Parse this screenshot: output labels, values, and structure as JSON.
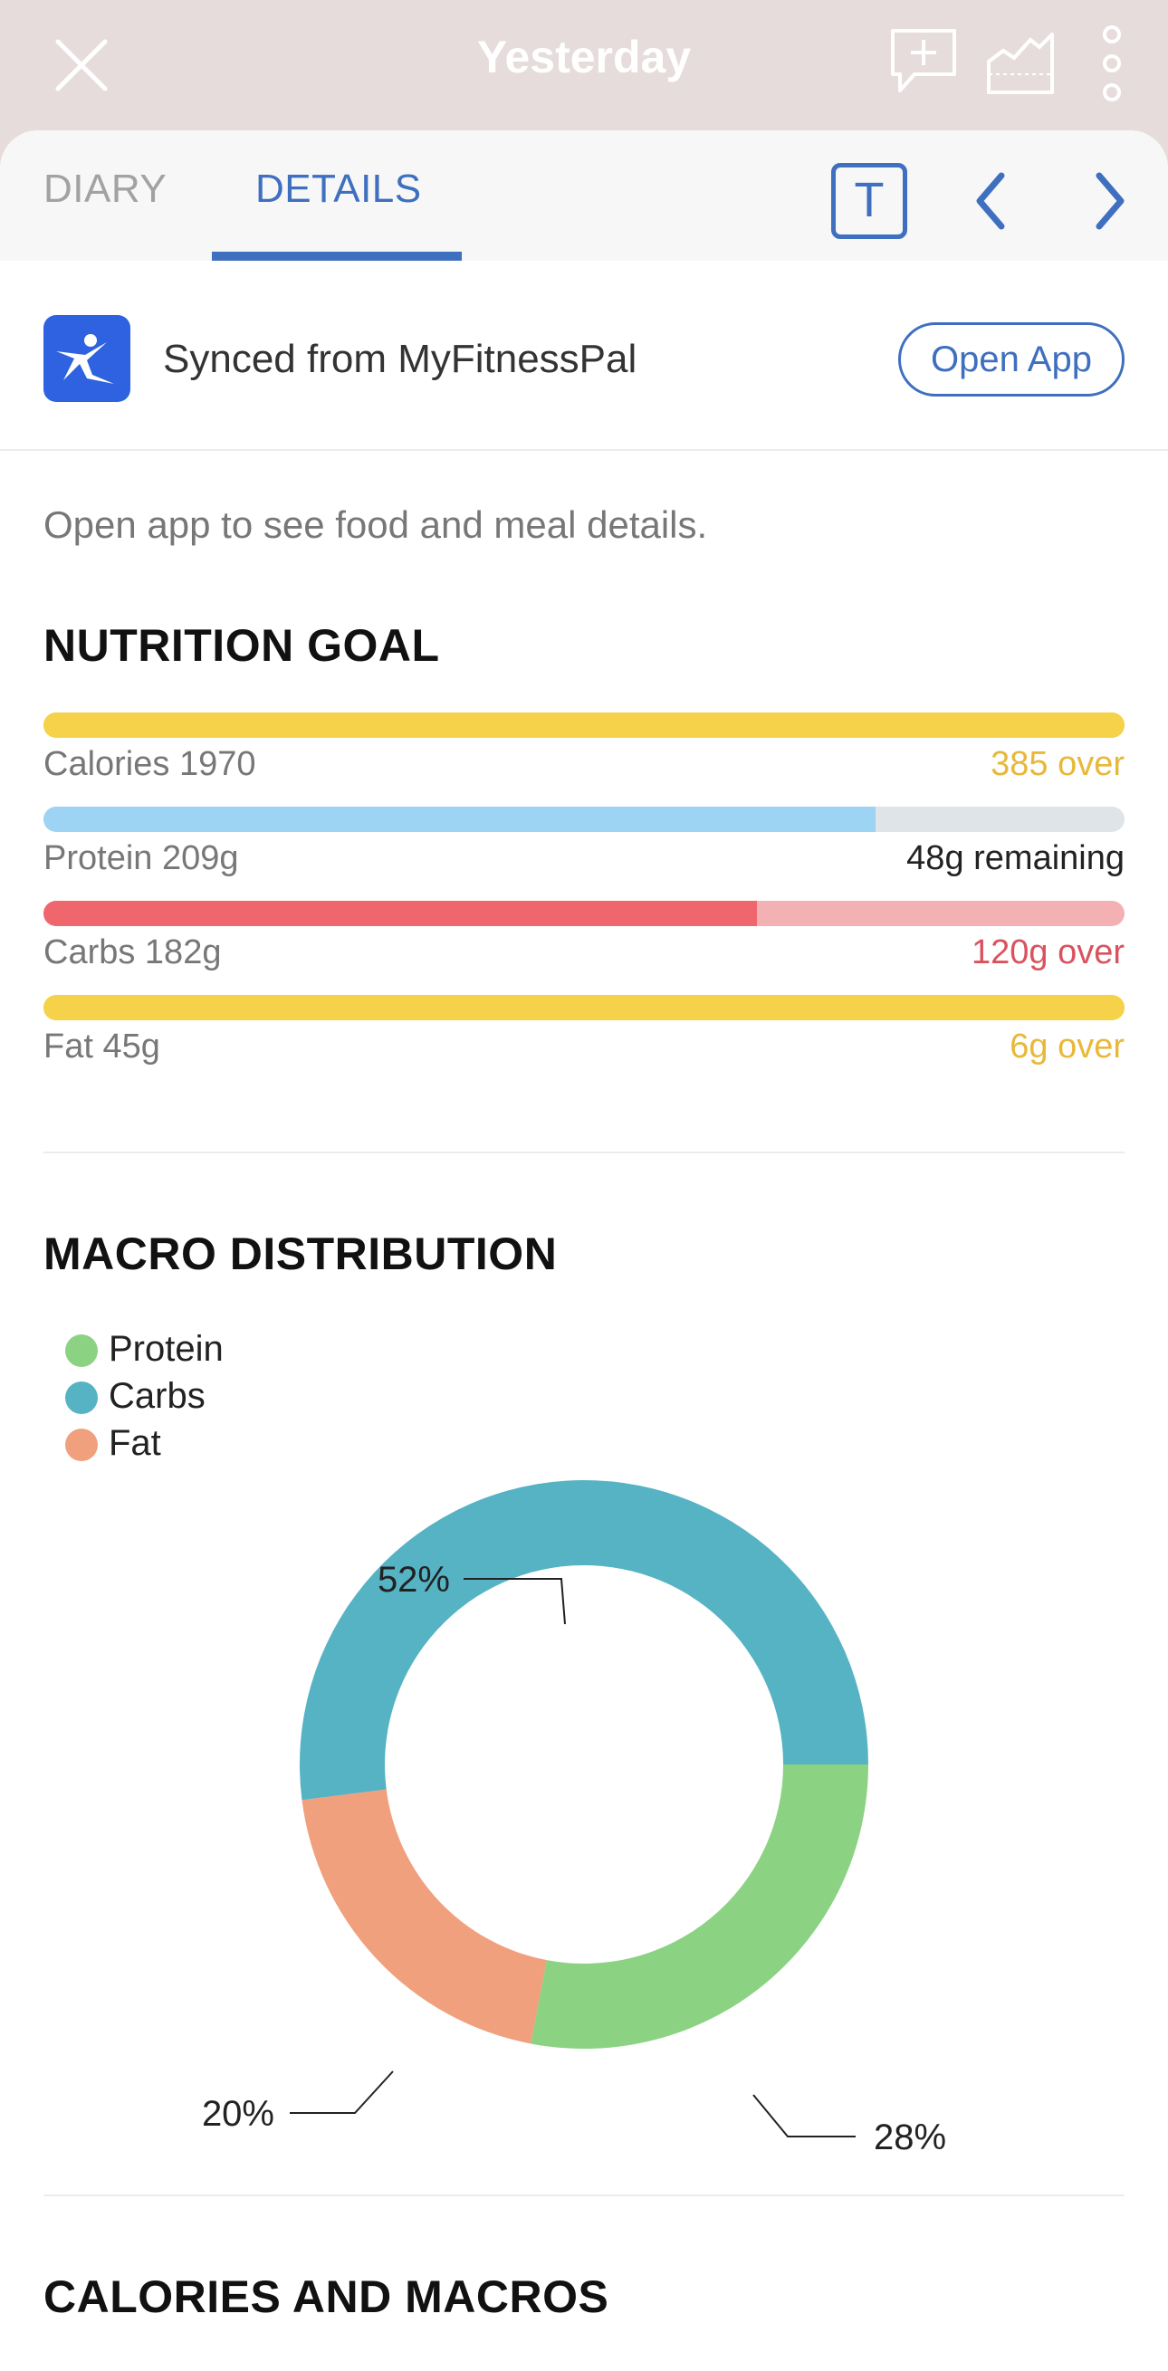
{
  "header": {
    "title": "Yesterday",
    "close_icon": "close-icon",
    "add_comment_icon": "add-comment-icon",
    "trend_chart_icon": "trend-chart-icon",
    "more_icon": "more-vertical-icon"
  },
  "tabs": {
    "diary": "DIARY",
    "details": "DETAILS",
    "active": "DETAILS",
    "text_button": "T",
    "prev_icon": "chevron-left-icon",
    "next_icon": "chevron-right-icon"
  },
  "sync": {
    "label": "Synced from MyFitnessPal",
    "button": "Open App",
    "logo_icon": "myfitnesspal-logo-icon"
  },
  "info_text": "Open app to see food and meal details.",
  "nutrition_goal": {
    "title": "NUTRITION GOAL",
    "bars": [
      {
        "label": "Calories 1970",
        "status": "385 over",
        "fill_fraction": 1.0,
        "fill_color": "#f6d24a",
        "track_color": "#f6d24a",
        "status_color": "#e8b83a"
      },
      {
        "label": "Protein 209g",
        "status": "48g remaining",
        "fill_fraction": 0.77,
        "fill_color": "#9dd3f3",
        "track_color": "#dfe4e8",
        "status_color": "#222222"
      },
      {
        "label": "Carbs 182g",
        "status": "120g over",
        "fill_fraction": 0.66,
        "fill_color": "#ef666c",
        "track_color": "#f4b1b4",
        "status_color": "#d9535e"
      },
      {
        "label": "Fat 45g",
        "status": "6g over",
        "fill_fraction": 1.0,
        "fill_color": "#f6d24a",
        "track_color": "#f6d24a",
        "status_color": "#e8b83a"
      }
    ]
  },
  "macro_distribution": {
    "title": "MACRO DISTRIBUTION"
  },
  "chart_data": {
    "type": "pie",
    "categories": [
      "Protein",
      "Carbs",
      "Fat"
    ],
    "values": [
      28,
      52,
      20
    ],
    "labels": [
      "28%",
      "52%",
      "20%"
    ],
    "colors": [
      "#8bd283",
      "#55b3c4",
      "#f0a07d"
    ],
    "legend": "top-left"
  },
  "calories_and_macros": {
    "title": "CALORIES AND MACROS"
  }
}
